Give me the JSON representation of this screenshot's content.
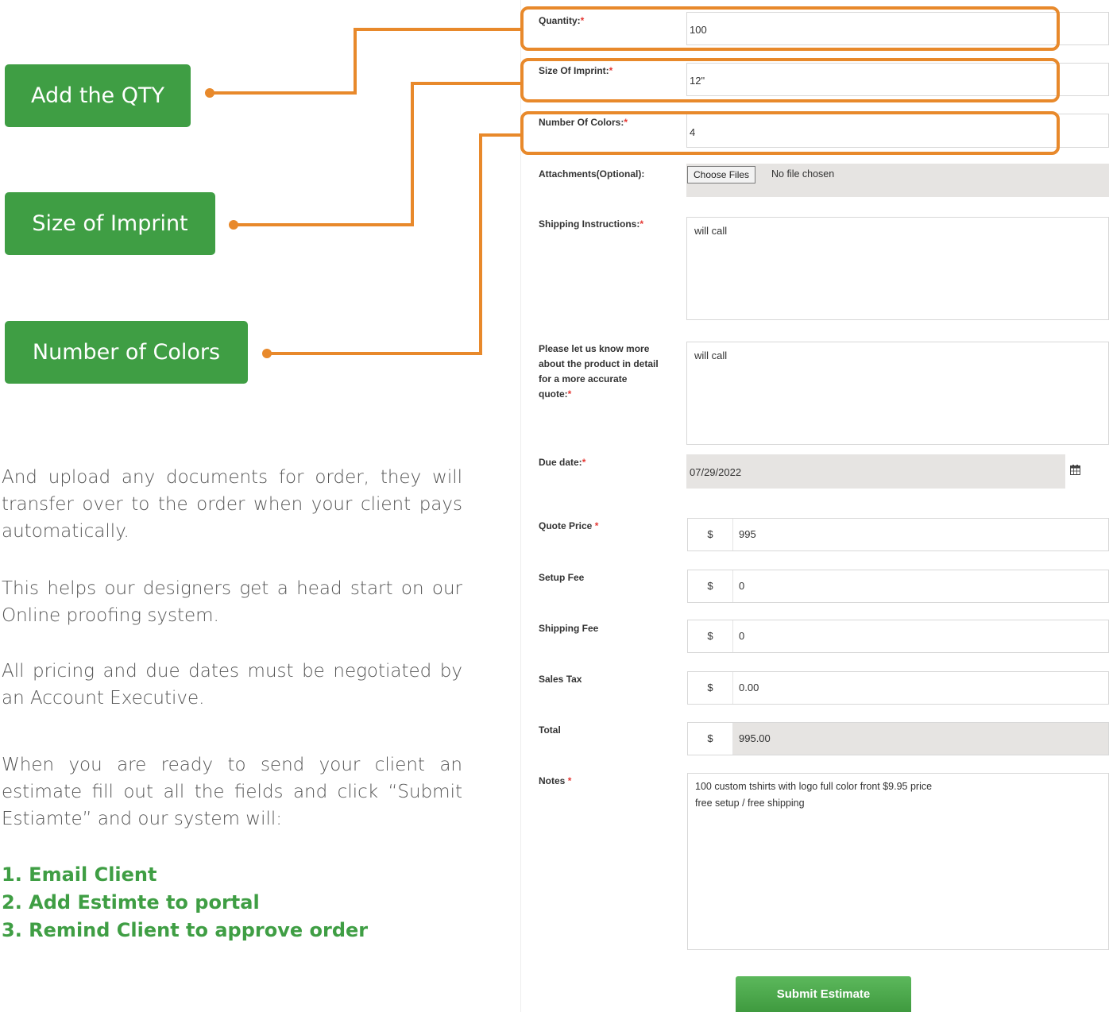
{
  "callouts": {
    "qty": "Add the QTY",
    "imprint": "Size of Imprint",
    "colors": "Number of Colors"
  },
  "instructions": {
    "p1": "And upload any documents for order, they will transfer over to the order when your client pays automatically.",
    "p2": "This helps our designers get a head start on our Online proofing system.",
    "p3": "All pricing and due dates must be negotiated by an Account Executive.",
    "p4": "When you are ready to send your client an estimate fill out all the fields and click “Submit Estiamte” and our system will:",
    "steps": [
      "1. Email Client",
      "2.  Add Estimte to portal",
      "3.  Remind Client to approve order"
    ]
  },
  "form": {
    "quantity": {
      "label": "Quantity:",
      "value": "100"
    },
    "imprint_size": {
      "label": "Size Of Imprint:",
      "value": "12\""
    },
    "num_colors": {
      "label": "Number Of Colors:",
      "value": "4"
    },
    "attachments": {
      "label": "Attachments(Optional):",
      "button": "Choose Files",
      "status": "No file chosen"
    },
    "shipping_instructions": {
      "label": "Shipping Instructions:",
      "value": "will call"
    },
    "product_details": {
      "label": "Please let us know more about the product in detail for a more accurate quote:",
      "value": "will call"
    },
    "due_date": {
      "label": "Due date:",
      "value": "07/29/2022"
    },
    "quote_price": {
      "label": "Quote Price",
      "currency": "$",
      "value": "995"
    },
    "setup_fee": {
      "label": "Setup Fee",
      "currency": "$",
      "value": "0"
    },
    "shipping_fee": {
      "label": "Shipping Fee",
      "currency": "$",
      "value": "0"
    },
    "sales_tax": {
      "label": "Sales Tax",
      "currency": "$",
      "value": "0.00"
    },
    "total": {
      "label": "Total",
      "currency": "$",
      "value": "995.00"
    },
    "notes": {
      "label": "Notes",
      "line1": "100 custom tshirts with logo full color front $9.95 price",
      "line2": "free setup / free shipping"
    },
    "required_mark": "*",
    "submit": "Submit Estimate"
  },
  "colors": {
    "accent_green": "#3f9e44",
    "highlight_orange": "#e8892b",
    "required_red": "#e53935"
  },
  "icons": {
    "due_date": "calendar-icon"
  }
}
